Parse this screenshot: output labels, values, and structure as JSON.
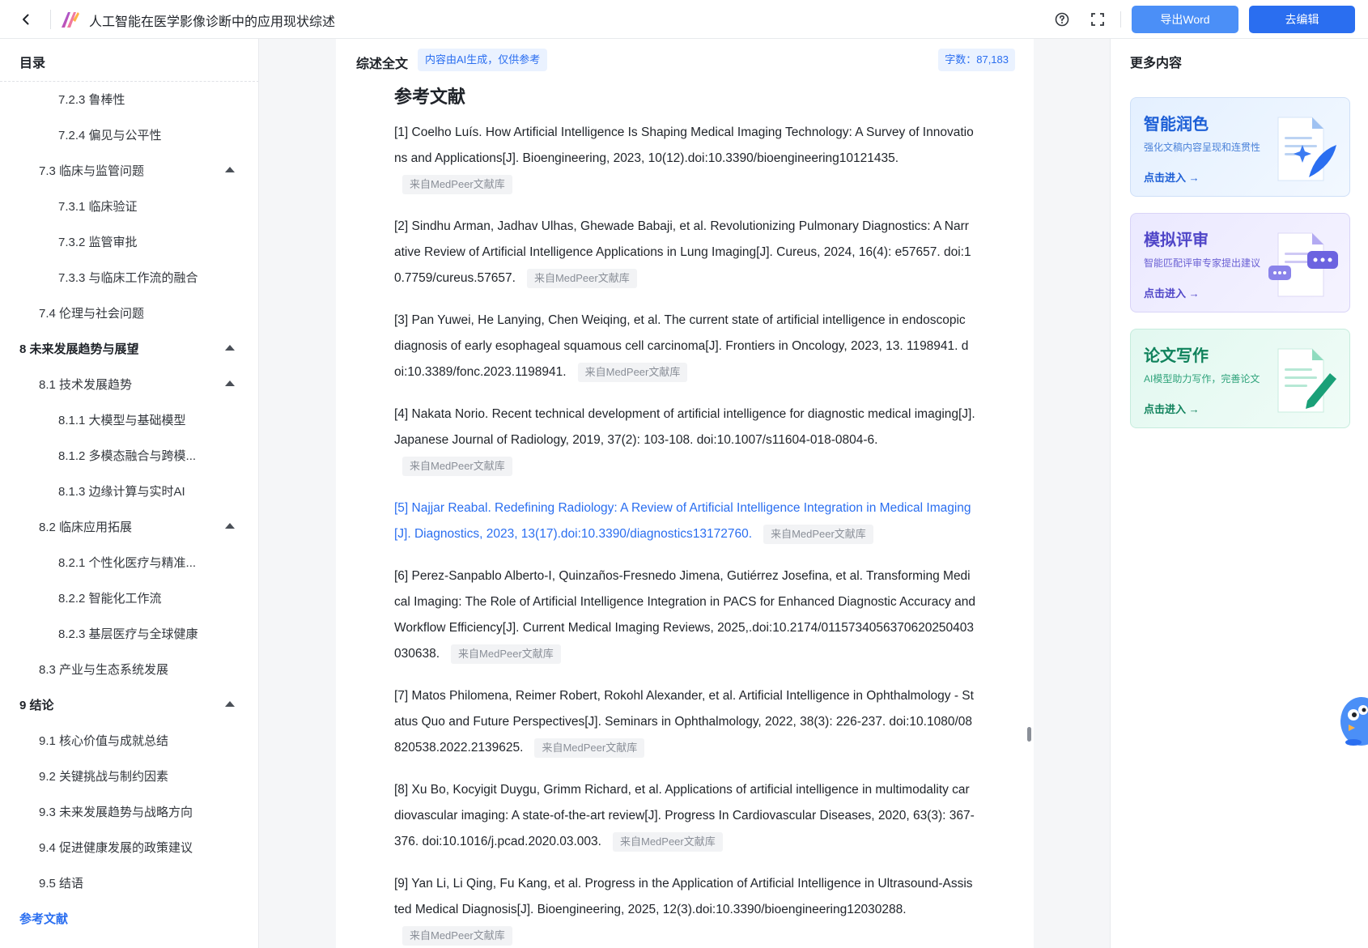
{
  "header": {
    "title": "人工智能在医学影像诊断中的应用现状综述",
    "export_label": "导出Word",
    "edit_label": "去编辑"
  },
  "sidebar": {
    "title": "目录",
    "items": [
      {
        "label": "7.2.3 鲁棒性",
        "level": 3
      },
      {
        "label": "7.2.4 偏见与公平性",
        "level": 3
      },
      {
        "label": "7.3 临床与监管问题",
        "level": 2,
        "expanded": true
      },
      {
        "label": "7.3.1 临床验证",
        "level": 3
      },
      {
        "label": "7.3.2 监管审批",
        "level": 3
      },
      {
        "label": "7.3.3 与临床工作流的融合",
        "level": 3
      },
      {
        "label": "7.4 伦理与社会问题",
        "level": 2
      },
      {
        "label": "8 未来发展趋势与展望",
        "level": 1,
        "expanded": true
      },
      {
        "label": "8.1 技术发展趋势",
        "level": 2,
        "expanded": true
      },
      {
        "label": "8.1.1 大模型与基础模型",
        "level": 3
      },
      {
        "label": "8.1.2 多模态融合与跨模...",
        "level": 3
      },
      {
        "label": "8.1.3 边缘计算与实时AI",
        "level": 3
      },
      {
        "label": "8.2 临床应用拓展",
        "level": 2,
        "expanded": true
      },
      {
        "label": "8.2.1 个性化医疗与精准...",
        "level": 3
      },
      {
        "label": "8.2.2 智能化工作流",
        "level": 3
      },
      {
        "label": "8.2.3 基层医疗与全球健康",
        "level": 3
      },
      {
        "label": "8.3 产业与生态系统发展",
        "level": 2
      },
      {
        "label": "9 结论",
        "level": 1,
        "expanded": true
      },
      {
        "label": "9.1 核心价值与成就总结",
        "level": 2
      },
      {
        "label": "9.2 关键挑战与制约因素",
        "level": 2
      },
      {
        "label": "9.3 未来发展趋势与战略方向",
        "level": 2
      },
      {
        "label": "9.4 促进健康发展的政策建议",
        "level": 2
      },
      {
        "label": "9.5 结语",
        "level": 2
      },
      {
        "label": "参考文献",
        "level": 1,
        "active": true
      }
    ]
  },
  "main": {
    "label": "综述全文",
    "ai_badge": "内容由AI生成，仅供参考",
    "wordcount": "字数：87,183",
    "ref_heading": "参考文献",
    "source_tag": "来自MedPeer文献库",
    "references": [
      {
        "text": "[1] Coelho Luís. How Artificial Intelligence Is Shaping Medical Imaging Technology: A Survey of Innovations and Applications[J]. Bioengineering, 2023, 10(12).doi:10.3390/bioengineering10121435."
      },
      {
        "text": "[2] Sindhu Arman, Jadhav Ulhas, Ghewade Babaji, et al. Revolutionizing Pulmonary Diagnostics: A Narrative Review of Artificial Intelligence Applications in Lung Imaging[J]. Cureus, 2024, 16(4): e57657. doi:10.7759/cureus.57657."
      },
      {
        "text": "[3] Pan Yuwei, He Lanying, Chen Weiqing, et al. The current state of artificial intelligence in endoscopic diagnosis of early esophageal squamous cell carcinoma[J]. Frontiers in Oncology, 2023, 13. 1198941. doi:10.3389/fonc.2023.1198941."
      },
      {
        "text": "[4] Nakata Norio. Recent technical development of artificial intelligence for diagnostic medical imaging[J]. Japanese Journal of Radiology, 2019, 37(2): 103-108. doi:10.1007/s11604-018-0804-6."
      },
      {
        "text": "[5] Najjar Reabal. Redefining Radiology: A Review of Artificial Intelligence Integration in Medical Imaging[J]. Diagnostics, 2023, 13(17).doi:10.3390/diagnostics13172760."
      },
      {
        "text": "[6] Perez-Sanpablo Alberto-I, Quinzaños-Fresnedo Jimena, Gutiérrez Josefina, et al. Transforming Medical Imaging: The Role of Artificial Intelligence Integration in PACS for Enhanced Diagnostic Accuracy and Workflow Efficiency[J]. Current Medical Imaging Reviews, 2025,.doi:10.2174/0115734056370620250403030638."
      },
      {
        "text": "[7] Matos Philomena, Reimer Robert, Rokohl Alexander, et al. Artificial Intelligence in Ophthalmology - Status Quo and Future Perspectives[J]. Seminars in Ophthalmology, 2022, 38(3): 226-237. doi:10.1080/08820538.2022.2139625."
      },
      {
        "text": "[8] Xu Bo, Kocyigit Duygu, Grimm Richard, et al. Applications of artificial intelligence in multimodality cardiovascular imaging: A state-of-the-art review[J]. Progress In Cardiovascular Diseases, 2020, 63(3): 367-376. doi:10.1016/j.pcad.2020.03.003."
      },
      {
        "text": "[9] Yan Li, Li Qing, Fu Kang, et al. Progress in the Application of Artificial Intelligence in Ultrasound-Assisted Medical Diagnosis[J]. Bioengineering, 2025, 12(3).doi:10.3390/bioengineering12030288."
      }
    ]
  },
  "rpanel": {
    "title": "更多内容",
    "cards": [
      {
        "title": "智能润色",
        "sub": "强化文稿内容呈现和连贯性",
        "enter": "点击进入 →"
      },
      {
        "title": "模拟评审",
        "sub": "智能匹配评审专家提出建议",
        "enter": "点击进入 →"
      },
      {
        "title": "论文写作",
        "sub": "AI模型助力写作，完善论文",
        "enter": "点击进入 →"
      }
    ]
  },
  "colors": {
    "primary": "#2a6ef0",
    "export_button": "#4b8ff7"
  }
}
